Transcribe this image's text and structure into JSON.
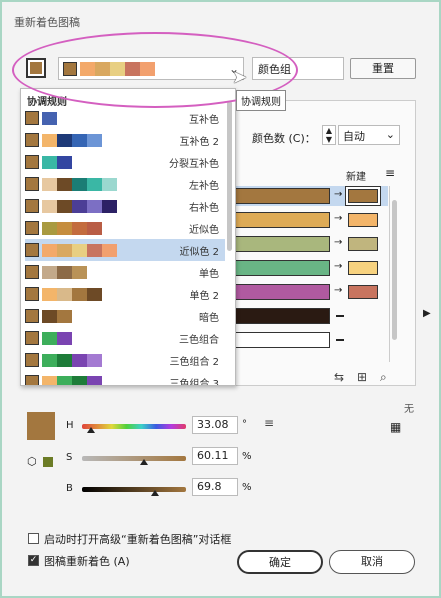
{
  "window": {
    "title": "重新着色图稿"
  },
  "header": {
    "strip_colors": [
      "#f3a96a",
      "#d9a860",
      "#e8cf82",
      "#c8745f",
      "#f2a06e"
    ],
    "main_swatch_color": "#a3773f",
    "name_value": "颜色组",
    "reset_label": "重置",
    "tooltip": "协调规则"
  },
  "harmony": {
    "header": "协调规则",
    "rules": [
      {
        "label": "互补色",
        "colors": [
          "#a3773f",
          "#4562b0"
        ]
      },
      {
        "label": "互补色 2",
        "colors": [
          "#a3773f",
          "#f3b56a",
          "#1e3a78",
          "#3565b4",
          "#6c95d6"
        ]
      },
      {
        "label": "分裂互补色",
        "colors": [
          "#a3773f",
          "#3ab7a5",
          "#3346a1"
        ]
      },
      {
        "label": "左补色",
        "colors": [
          "#a3773f",
          "#e7c8a0",
          "#6d4a26",
          "#1b7d75",
          "#3ab7a5",
          "#9bd8cf"
        ]
      },
      {
        "label": "右补色",
        "colors": [
          "#a3773f",
          "#e7c8a0",
          "#6d4a26",
          "#4c3e96",
          "#7c6fc4",
          "#2c2165"
        ]
      },
      {
        "label": "近似色",
        "colors": [
          "#a3773f",
          "#a99a40",
          "#c58d3e",
          "#c36c3e",
          "#b95d45"
        ]
      },
      {
        "label": "近似色 2",
        "colors": [
          "#a3773f",
          "#f3a96a",
          "#d9a860",
          "#e8cf82",
          "#c8745f",
          "#f2a06e"
        ]
      },
      {
        "label": "单色",
        "colors": [
          "#a3773f",
          "#c3a98a",
          "#8c6a47",
          "#b99257"
        ]
      },
      {
        "label": "单色 2",
        "colors": [
          "#a3773f",
          "#f3b56a",
          "#d9b98a",
          "#a3773f",
          "#6d4a26"
        ]
      },
      {
        "label": "暗色",
        "colors": [
          "#a3773f",
          "#6d4a26",
          "#a3773f"
        ]
      },
      {
        "label": "三色组合",
        "colors": [
          "#a3773f",
          "#3dae5b",
          "#7a44b1"
        ]
      },
      {
        "label": "三色组合 2",
        "colors": [
          "#a3773f",
          "#3dae5b",
          "#1e7c39",
          "#7a44b1",
          "#a47ad2"
        ]
      },
      {
        "label": "三色组合 3",
        "colors": [
          "#a3773f",
          "#f3b56a",
          "#3dae5b",
          "#1e7c39",
          "#7a44b1"
        ]
      }
    ],
    "selected_index": 6
  },
  "colors_panel": {
    "count_label": "颜色数 (C)：",
    "count_value": "自动",
    "new_label": "新建",
    "rows": [
      {
        "current": "#a3773f",
        "target": "#a3773f",
        "selected": true
      },
      {
        "current": "#deab56",
        "target": "#f3b56a",
        "selected": false
      },
      {
        "current": "#a9b77d",
        "target": "#c0b57e",
        "selected": false
      },
      {
        "current": "#69b585",
        "target": "#f7d27f",
        "selected": false
      },
      {
        "current": "#b05aa0",
        "target": "#c8745f",
        "selected": false
      },
      {
        "current": "#2a1a12",
        "target": null,
        "selected": false
      },
      {
        "current": "#ffffff",
        "target": null,
        "selected": false
      }
    ]
  },
  "hsb": {
    "h_label": "H",
    "h_value": "33.08",
    "h_unit": "°",
    "h_fraction": 0.09,
    "s_label": "S",
    "s_value": "60.11",
    "s_unit": "%",
    "s_fraction": 0.6,
    "b_label": "B",
    "b_value": "69.8",
    "b_unit": "%",
    "b_fraction": 0.7,
    "swatch_color": "#a3773f",
    "gamut_color": "#6b7b25",
    "wu_label": "无"
  },
  "footer": {
    "open_advanced_label": "启动时打开高级“重新着色图稿”对话框",
    "open_advanced_checked": false,
    "recolor_label": "图稿重新着色 (A)",
    "recolor_checked": true,
    "ok_label": "确定",
    "cancel_label": "取消"
  }
}
